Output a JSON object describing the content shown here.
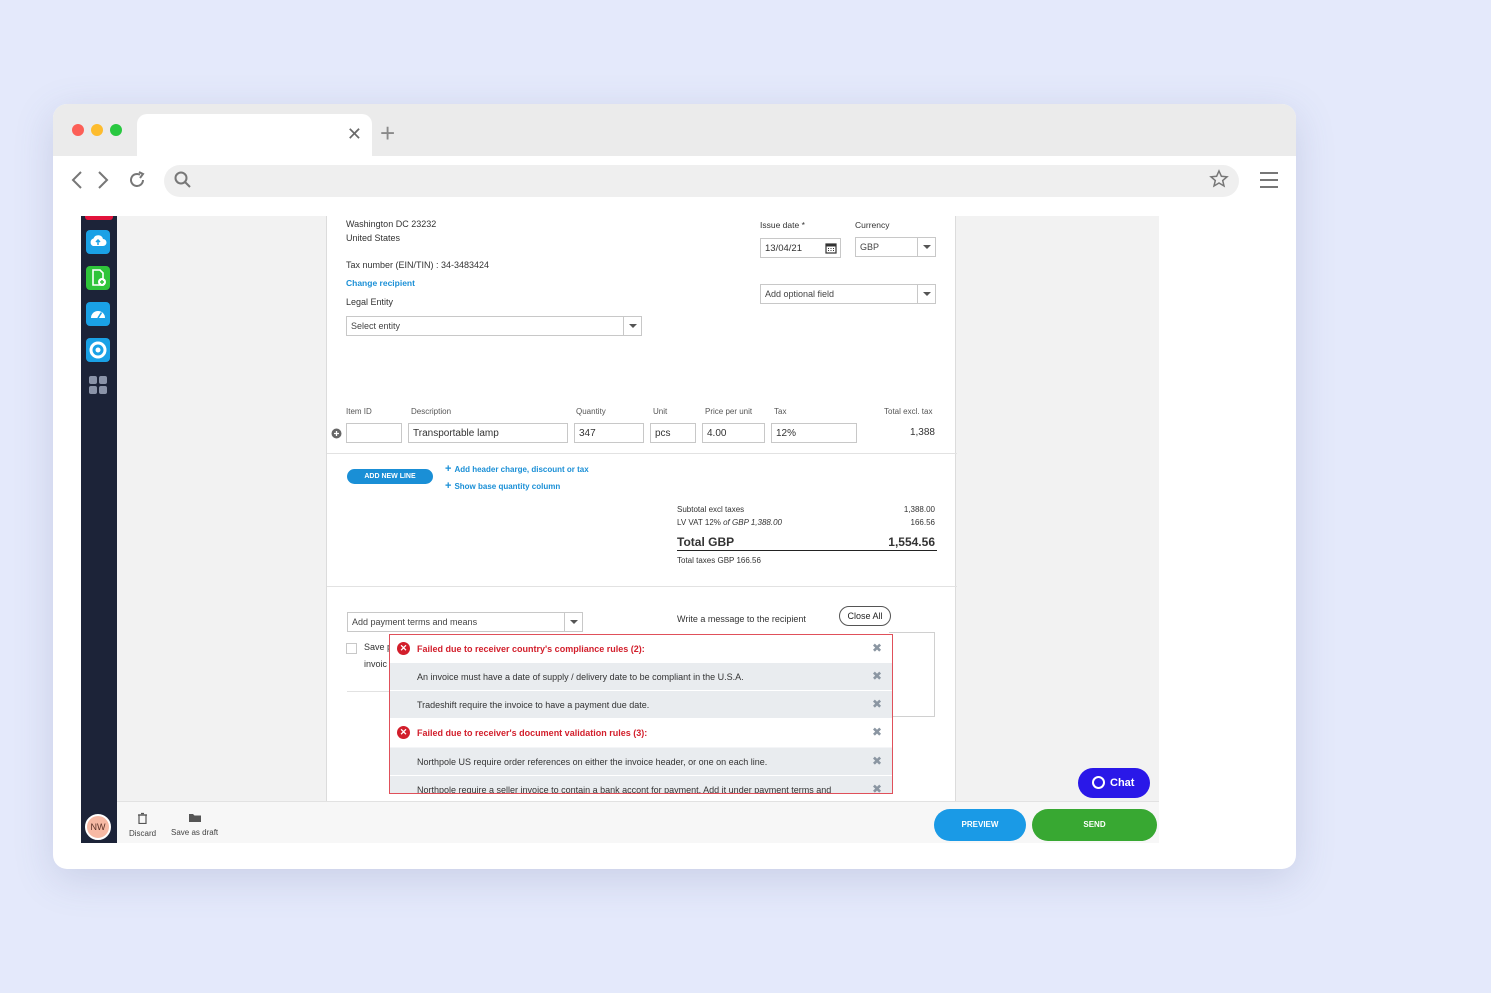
{
  "browser": {
    "tab_close": "✕",
    "new_tab": "+"
  },
  "recipient": {
    "address_line": "Washington   DC   23232",
    "country": "United States",
    "tax_number": "Tax number (EIN/TIN)  : 34-3483424",
    "change_link": "Change recipient",
    "legal_entity_label": "Legal Entity",
    "legal_entity_value": "Select entity"
  },
  "header_fields": {
    "issue_date_label": "Issue date *",
    "issue_date_value": "13/04/21",
    "currency_label": "Currency",
    "currency_value": "GBP",
    "optional_field": "Add optional field"
  },
  "line_items": {
    "columns": [
      "Item ID",
      "Description",
      "Quantity",
      "Unit",
      "Price per unit",
      "Tax",
      "Total excl. tax"
    ],
    "rows": [
      {
        "item_id": "",
        "description": "Transportable lamp",
        "quantity": "347",
        "unit": "pcs",
        "price": "4.00",
        "tax": "12%",
        "total": "1,388"
      }
    ],
    "add_new_line": "ADD NEW LINE",
    "add_header_charge": "Add header charge, discount or tax",
    "show_base_quantity": "Show base quantity column"
  },
  "totals": {
    "subtotal_label": "Subtotal excl taxes",
    "subtotal_value": "1,388.00",
    "vat_label_prefix": "LV VAT 12% ",
    "vat_label_suffix": "of GBP 1,388.00",
    "vat_value": "166.56",
    "total_label": "Total GBP",
    "total_value": "1,554.56",
    "total_taxes": "Total taxes GBP 166.56"
  },
  "payment": {
    "terms_placeholder": "Add payment terms and means",
    "save_prefix": "Save p",
    "save_second": "invoic",
    "message_label": "Write a message to the recipient",
    "close_all": "Close All"
  },
  "errors": [
    {
      "type": "header",
      "text": "Failed due to receiver country's compliance rules (2):"
    },
    {
      "type": "item",
      "text": "An invoice must have a date of supply / delivery date to be compliant in the U.S.A."
    },
    {
      "type": "item",
      "text": "Tradeshift require the invoice to have a payment due date."
    },
    {
      "type": "header",
      "text": "Failed due to receiver's document validation rules (3):"
    },
    {
      "type": "item",
      "text": "Northpole US require order references on either the invoice header, or one on each line."
    },
    {
      "type": "item",
      "text": "Northpole require a seller invoice to contain a bank accont for payment. Add it under payment terms and"
    }
  ],
  "error_icon_glyph": "✕",
  "error_close_glyph": "✖",
  "chat": {
    "label": "Chat"
  },
  "footer": {
    "discard": "Discard",
    "save_draft": "Save as draft",
    "preview": "PREVIEW",
    "send": "SEND"
  },
  "user": {
    "initials": "NW"
  },
  "colors": {
    "accent_blue": "#1a8fd6",
    "send_green": "#38a832",
    "error_red": "#d21e2b",
    "chat_purple": "#2a18e8",
    "nav_dark": "#1c2338"
  }
}
